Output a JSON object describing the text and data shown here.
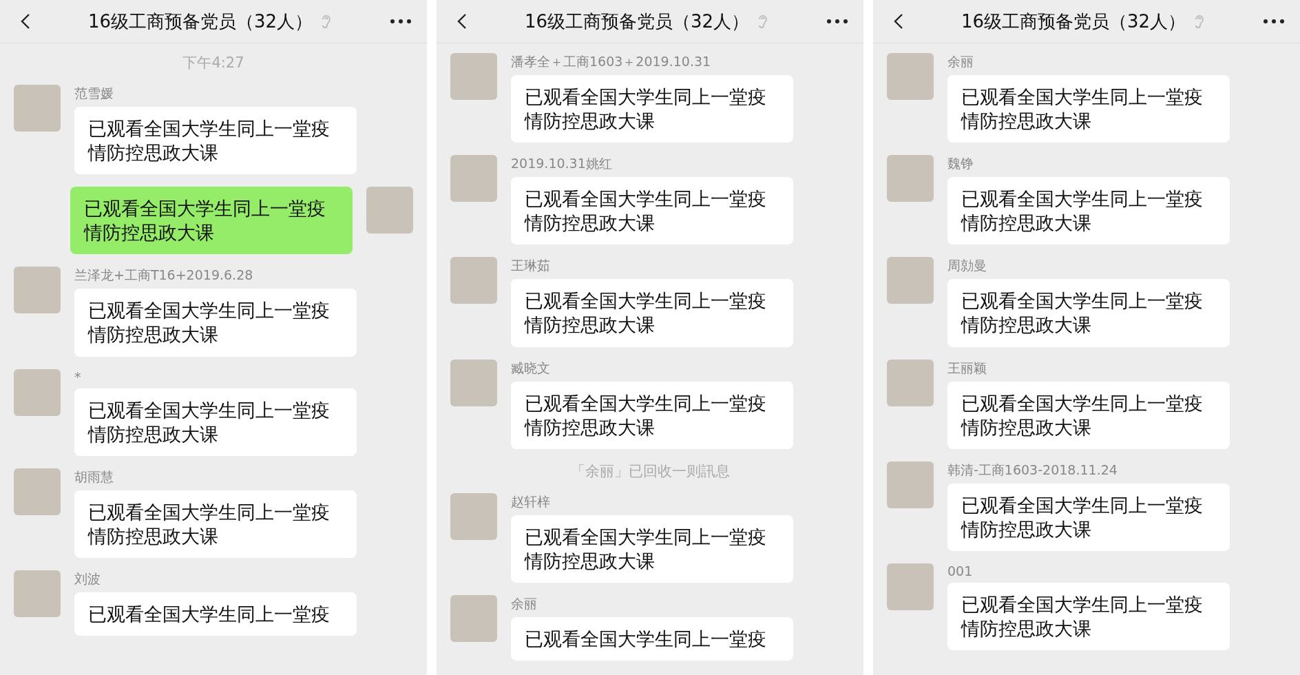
{
  "panels": [
    {
      "title": "16级工商预备党员（32人）",
      "messages": [
        {
          "kind": "time",
          "text": "下午4:27"
        },
        {
          "kind": "other",
          "sender": "范雪媛",
          "text": "已观看全国大学生同上一堂疫情防控思政大课"
        },
        {
          "kind": "self",
          "text": "已观看全国大学生同上一堂疫情防控思政大课"
        },
        {
          "kind": "other",
          "sender": "兰泽龙+工商T16+2019.6.28",
          "text": "已观看全国大学生同上一堂疫情防控思政大课"
        },
        {
          "kind": "other",
          "sender": "*",
          "text": "已观看全国大学生同上一堂疫情防控思政大课"
        },
        {
          "kind": "other",
          "sender": "胡雨慧",
          "text": "已观看全国大学生同上一堂疫情防控思政大课"
        },
        {
          "kind": "other",
          "sender": "刘波",
          "text": "已观看全国大学生同上一堂疫"
        }
      ]
    },
    {
      "title": "16级工商预备党员（32人）",
      "messages": [
        {
          "kind": "other",
          "sender": "潘孝全＋工商1603＋2019.10.31",
          "text": "已观看全国大学生同上一堂疫情防控思政大课"
        },
        {
          "kind": "other",
          "sender": "2019.10.31姚红",
          "text": "已观看全国大学生同上一堂疫情防控思政大课"
        },
        {
          "kind": "other",
          "sender": "王琳茹",
          "text": "已观看全国大学生同上一堂疫情防控思政大课"
        },
        {
          "kind": "other",
          "sender": "臧晓文",
          "text": "已观看全国大学生同上一堂疫情防控思政大课"
        },
        {
          "kind": "system",
          "text": "「余丽」已回收一则訊息"
        },
        {
          "kind": "other",
          "sender": "赵轩梓",
          "text": "已观看全国大学生同上一堂疫情防控思政大课"
        },
        {
          "kind": "other",
          "sender": "余丽",
          "text": "已观看全国大学生同上一堂疫"
        }
      ]
    },
    {
      "title": "16级工商预备党员（32人）",
      "messages": [
        {
          "kind": "other",
          "sender": "余丽",
          "text": "已观看全国大学生同上一堂疫情防控思政大课"
        },
        {
          "kind": "other",
          "sender": "魏铮",
          "text": "已观看全国大学生同上一堂疫情防控思政大课"
        },
        {
          "kind": "other",
          "sender": "周勍曼",
          "text": "已观看全国大学生同上一堂疫情防控思政大课"
        },
        {
          "kind": "other",
          "sender": "王丽颖",
          "text": "已观看全国大学生同上一堂疫情防控思政大课"
        },
        {
          "kind": "other",
          "sender": "韩清-工商1603-2018.11.24",
          "text": "已观看全国大学生同上一堂疫情防控思政大课"
        },
        {
          "kind": "other",
          "sender": "001",
          "text": "已观看全国大学生同上一堂疫情防控思政大课"
        }
      ]
    }
  ]
}
